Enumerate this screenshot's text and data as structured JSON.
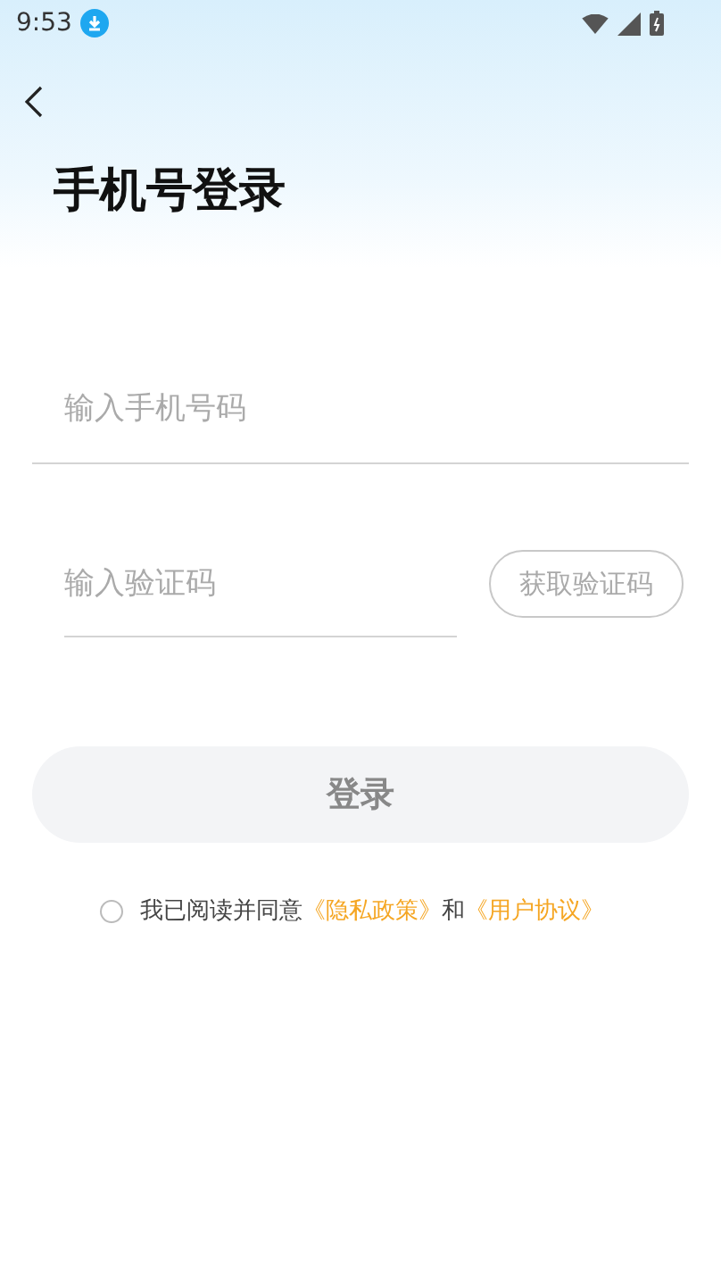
{
  "status_bar": {
    "time": "9:53"
  },
  "title": "手机号登录",
  "phone_field": {
    "placeholder": "输入手机号码"
  },
  "code_field": {
    "placeholder": "输入验证码"
  },
  "get_code_button": {
    "label": "获取验证码",
    "disabled": true
  },
  "login_button": {
    "label": "登录",
    "disabled": true
  },
  "agreement": {
    "checked": false,
    "text": "我已阅读并同意",
    "links": [
      "《隐私政策》",
      "《用户协议》"
    ],
    "joiner": "和"
  }
}
